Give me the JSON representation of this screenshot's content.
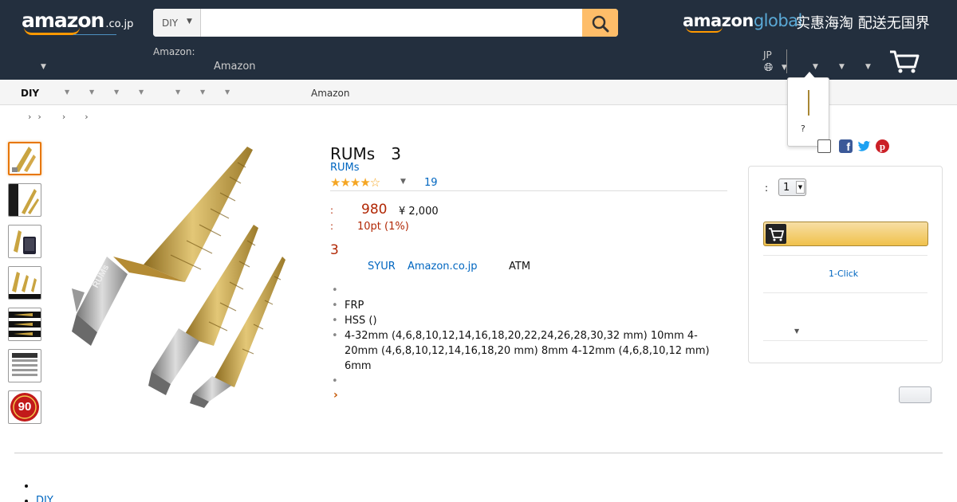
{
  "header": {
    "logo_word": "amazon",
    "logo_tld": ".co.jp",
    "search": {
      "category": "DIY",
      "value": "",
      "placeholder": ""
    },
    "global_logo_a": "amazon",
    "global_logo_b": "global",
    "global_tagline": "实惠海淘 配送无国界",
    "deliver_label": "Amazon:",
    "deliver_value": "Amazon",
    "language_code": "JP"
  },
  "account_popover": {
    "text": "?"
  },
  "sub_nav": {
    "title": "DIY",
    "link": "Amazon"
  },
  "breadcrumb": [
    "›",
    "›",
    "›",
    "›"
  ],
  "product": {
    "title": "RUMs　3",
    "brand": "RUMs",
    "stars": "★★★★☆",
    "rating_value": 4.5,
    "review_count": "19",
    "price_label": ":",
    "price": "980",
    "list_price": "¥ 2,000",
    "points_label": ":",
    "points": "10pt  (1%)",
    "stock": "3",
    "seller": "SYUR",
    "shipper": "Amazon.co.jp",
    "payment_note": "ATM",
    "bullets": [
      "",
      "FRP",
      "HSS ()",
      "4-32mm (4,6,8,10,12,14,16,18,20,22,24,26,28,30,32 mm) 10mm 4-20mm (4,6,8,10,12,14,16,18,20 mm) 8mm 4-12mm (4,6,8,10,12 mm) 6mm",
      ""
    ],
    "see_more": "›"
  },
  "buy_box": {
    "qty_label": ":",
    "qty_value": "1",
    "one_click": "1-Click"
  },
  "bottom_list": [
    "",
    "DIY"
  ],
  "colors": {
    "header_bg": "#232f3e",
    "price_red": "#b12704",
    "link_blue": "#0066c0",
    "accent_orange": "#febd69",
    "star_gold": "#f5a623"
  }
}
